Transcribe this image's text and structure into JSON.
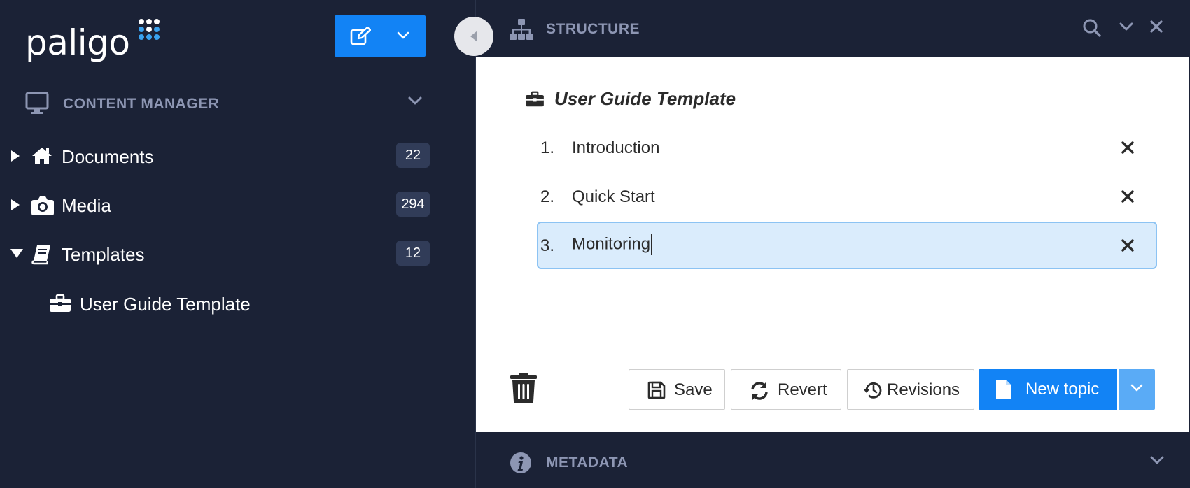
{
  "app": {
    "logo_text": "paligo"
  },
  "sidebar": {
    "section_title": "CONTENT MANAGER",
    "items": [
      {
        "label": "Documents",
        "count": "22",
        "icon": "home-icon",
        "expanded": false
      },
      {
        "label": "Media",
        "count": "294",
        "icon": "camera-icon",
        "expanded": false
      },
      {
        "label": "Templates",
        "count": "12",
        "icon": "book-icon",
        "expanded": true
      }
    ],
    "children": [
      {
        "label": "User Guide Template",
        "icon": "briefcase-icon"
      }
    ]
  },
  "structure": {
    "title": "STRUCTURE",
    "document_title": "User Guide Template",
    "topics": [
      {
        "number": "1.",
        "label": "Introduction"
      },
      {
        "number": "2.",
        "label": "Quick Start"
      },
      {
        "number": "3.",
        "label": "Monitoring"
      }
    ],
    "buttons": {
      "save": "Save",
      "revert": "Revert",
      "revisions": "Revisions",
      "new_topic": "New topic"
    }
  },
  "metadata": {
    "title": "METADATA"
  },
  "colors": {
    "background": "#1b2236",
    "accent": "#1283f5",
    "muted_heading": "#8d96b3",
    "active_row": "#daecfc"
  }
}
